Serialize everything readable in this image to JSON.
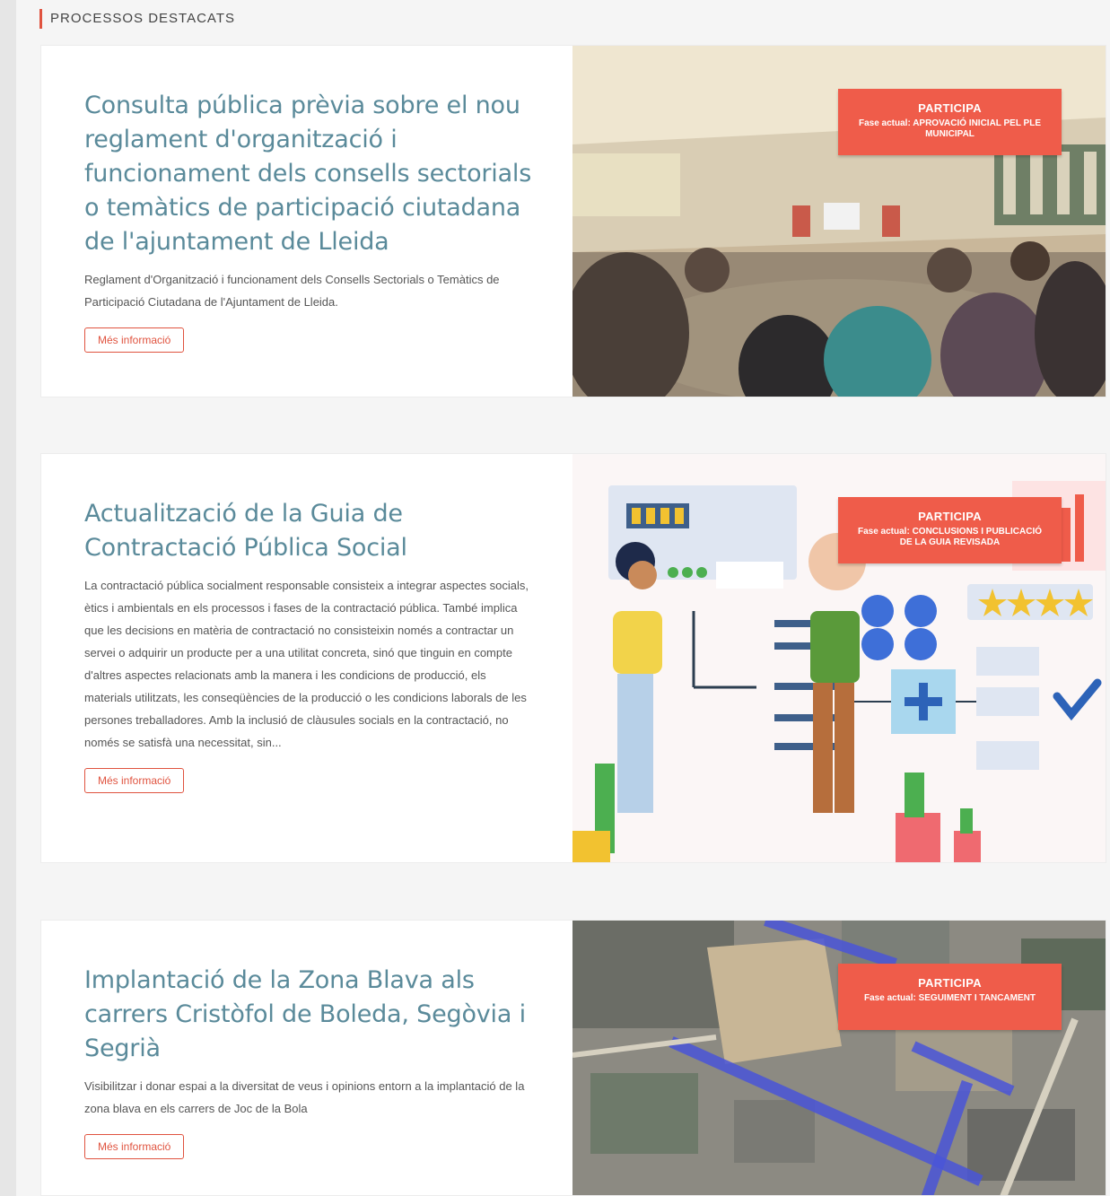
{
  "section": {
    "title": "PROCESSOS DESTACATS"
  },
  "cards": [
    {
      "title": "Consulta pública prèvia sobre el nou reglament d'organització i funcionament dels consells sectorials o temàtics de participació ciutadana de l'ajuntament de Lleida",
      "description": "Reglament d'Organització i funcionament dels Consells Sectorials o Temàtics de Participació Ciutadana de l'Ajuntament de Lleida.",
      "button": "Més informació",
      "badge": {
        "title": "PARTICIPA",
        "phase": "Fase actual: APROVACIÓ INICIAL PEL PLE MUNICIPAL"
      }
    },
    {
      "title": "Actualització de la Guia de Contractació Pública Social",
      "description": "La contractació pública socialment responsable consisteix a integrar aspectes socials, ètics i ambientals en els processos i fases de la contractació pública. També implica que les decisions en matèria de contractació no consisteixin només a contractar un servei o adquirir un producte per a una utilitat concreta, sinó que tinguin en compte d'altres aspectes relacionats amb la manera i les condicions de producció, els materials utilitzats, les conseqüències de la producció o les condicions laborals de les persones treballadores. Amb la inclusió de clàusules socials en la contractació, no només se satisfà una necessitat, sin...",
      "button": "Més informació",
      "badge": {
        "title": "PARTICIPA",
        "phase": "Fase actual: CONCLUSIONS I PUBLICACIÓ DE LA GUIA REVISADA"
      }
    },
    {
      "title": "Implantació de la Zona Blava als carrers Cristòfol de Boleda, Segòvia i Segrià",
      "description": "Visibilitzar i donar espai a la diversitat de veus i opinions entorn a la implantació de la zona blava en els carrers de Joc de la Bola",
      "button": "Més informació",
      "badge": {
        "title": "PARTICIPA",
        "phase": "Fase actual: SEGUIMENT I TANCAMENT"
      }
    }
  ],
  "colors": {
    "accent": "#ef5c4a",
    "title": "#5a8a9a"
  }
}
